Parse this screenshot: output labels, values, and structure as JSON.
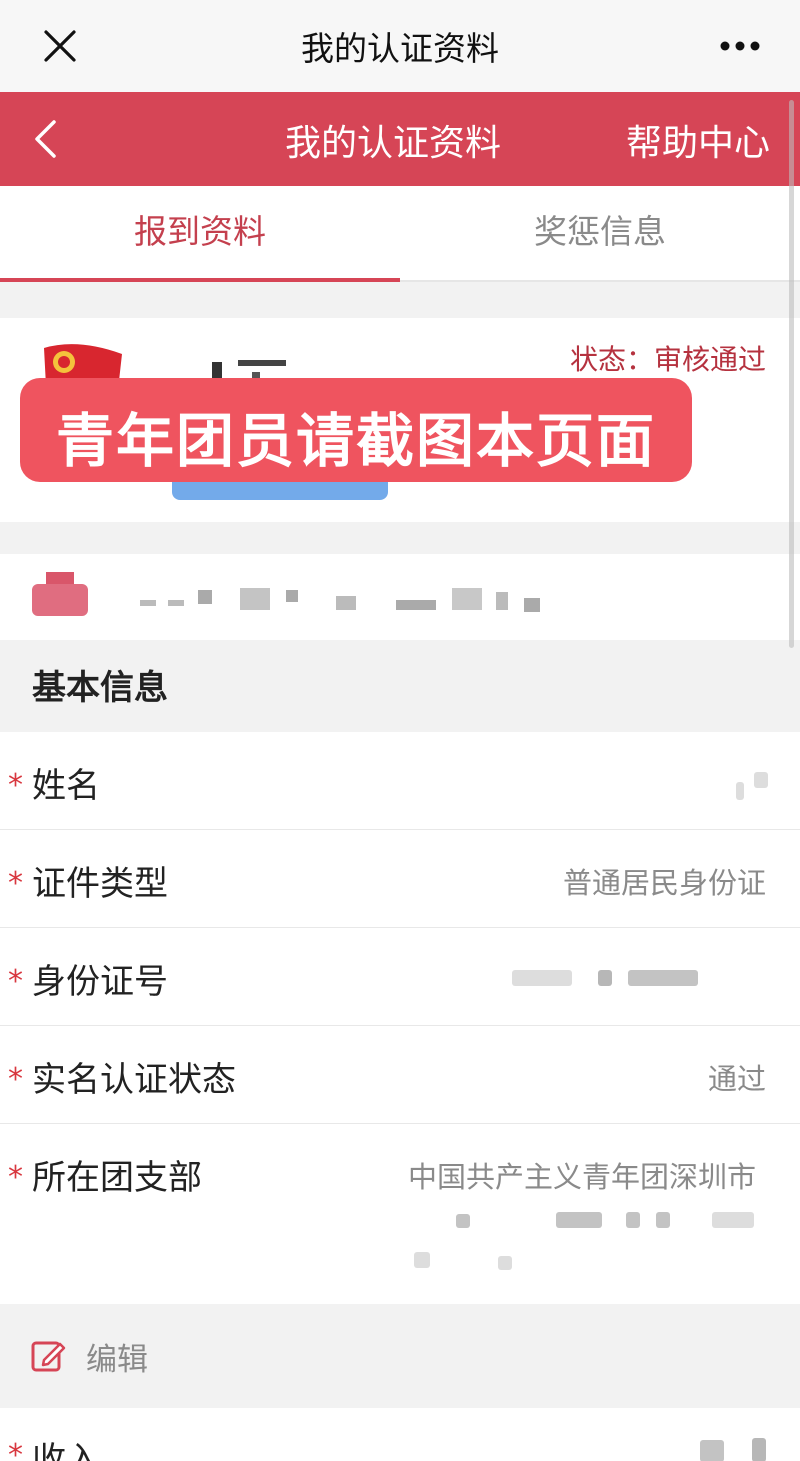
{
  "wechat_bar": {
    "title": "我的认证资料",
    "close_icon": "close-icon",
    "more_icon": "more-icon"
  },
  "app_bar": {
    "title": "我的认证资料",
    "help": "帮助中心",
    "back_icon": "chevron-left-icon"
  },
  "tabs": [
    {
      "label": "报到资料",
      "active": true
    },
    {
      "label": "奖惩信息",
      "active": false
    }
  ],
  "profile": {
    "status": "状态：审核通过"
  },
  "banner": {
    "text": "青年团员请截图本页面"
  },
  "basic_info": {
    "title": "基本信息",
    "fields": [
      {
        "label": "姓名",
        "value": ""
      },
      {
        "label": "证件类型",
        "value": "普通居民身份证"
      },
      {
        "label": "身份证号",
        "value": ""
      },
      {
        "label": "实名认证状态",
        "value": "通过"
      },
      {
        "label": "所在团支部",
        "value": "中国共产主义青年团深圳市"
      }
    ],
    "required_mark": "*"
  },
  "edit": {
    "label": "编辑"
  },
  "income_row": {
    "label": "收入"
  },
  "colors": {
    "brand_red": "#d64556",
    "tab_active": "#c4404e",
    "banner": "#ef545f",
    "status": "#b5323f"
  }
}
